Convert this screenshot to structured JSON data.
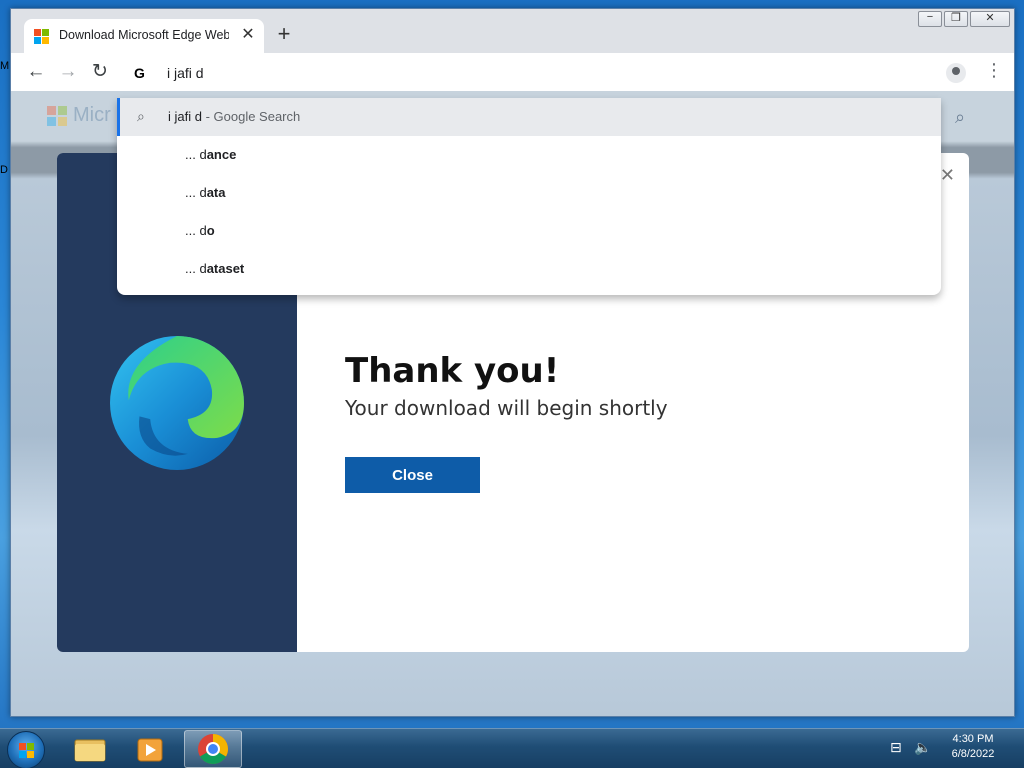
{
  "desktop": {
    "edge_letter_1": "M",
    "edge_letter_2": "D"
  },
  "window": {
    "tab_title": "Download Microsoft Edge Web Browser",
    "tab_close": "✕",
    "new_tab": "+",
    "controls": {
      "minimize": "−",
      "restore": "❐",
      "close": "✕"
    }
  },
  "toolbar": {
    "back": "←",
    "forward": "→",
    "reload": "↻",
    "google_letter": "G",
    "omnibox_value": "i jafi d",
    "menu": "⋮"
  },
  "dropdown": {
    "top_suggestion": {
      "query": "i jafi d",
      "suffix": " - Google Search"
    },
    "suggestions": [
      {
        "prefix": "... d",
        "completion": "ance"
      },
      {
        "prefix": "... d",
        "completion": "ata"
      },
      {
        "prefix": "... d",
        "completion": "o"
      },
      {
        "prefix": "... d",
        "completion": "ataset"
      }
    ]
  },
  "page": {
    "brand_partial": "Micr",
    "modal": {
      "heading": "Thank you!",
      "subheading": "Your download will begin shortly",
      "close_button": "Close",
      "dismiss": "✕"
    }
  },
  "taskbar": {
    "time": "4:30 PM",
    "date": "6/8/2022"
  },
  "colors": {
    "modal_side": "#243a5e",
    "close_button": "#0e5ca8",
    "taskbar": "#1f4d75"
  }
}
